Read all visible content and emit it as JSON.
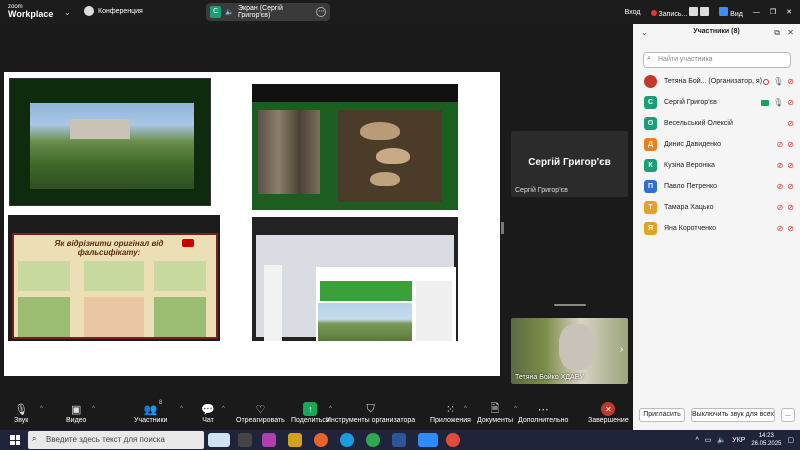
{
  "titlebar": {
    "logo_line1": "zoom",
    "logo_line2": "Workplace",
    "conference_label": "Конференция",
    "share_badge": "С",
    "share_label": "Экран (Сергій Григор'єв)",
    "login": "Вход",
    "recording": "Запись...",
    "view": "Вид"
  },
  "stage": {
    "slide_quote": "Як відрізнити оригінал від фальсифікату:",
    "speaker_thumb_name": "Сергій Григор'єв",
    "speaker_thumb_label": "Сергій Григор'єв",
    "video_thumb_label": "Тетяна Бойко ХДАЕУ"
  },
  "toolbar": {
    "audio": "Звук",
    "video": "Видео",
    "participants": "Участники",
    "participants_count": "8",
    "chat": "Чат",
    "react": "Отреагировать",
    "share": "Поделиться",
    "host_tools": "Инструменты организатора",
    "apps": "Приложения",
    "docs": "Документы",
    "more": "Дополнительно",
    "end": "Завершение"
  },
  "participants_panel": {
    "title": "Участники (8)",
    "search_placeholder": "Найти участника",
    "items": [
      {
        "initial": "",
        "name": "Тетяна Бой... (Организатор, я)",
        "color": "#c0392b"
      },
      {
        "initial": "С",
        "name": "Сергій Григор'єв",
        "color": "#1b9e77"
      },
      {
        "initial": "О",
        "name": "Весельський Олексій",
        "color": "#1b9e77"
      },
      {
        "initial": "Д",
        "name": "Динис Давиденко",
        "color": "#e67e22"
      },
      {
        "initial": "К",
        "name": "Кузіна Вероніка",
        "color": "#1b9e77"
      },
      {
        "initial": "П",
        "name": "Павло Петренко",
        "color": "#2e6fd1"
      },
      {
        "initial": "Т",
        "name": "Тамара Хацько",
        "color": "#e6a02a"
      },
      {
        "initial": "Я",
        "name": "Яна Коротченко",
        "color": "#e6a02a"
      }
    ],
    "invite": "Пригласить",
    "mute_all": "Выключить звук для всех",
    "more": "..."
  },
  "taskbar": {
    "search_text": "Введите здесь текст для поиска",
    "lang": "УКР",
    "time": "14:23",
    "date": "26.05.2025"
  }
}
